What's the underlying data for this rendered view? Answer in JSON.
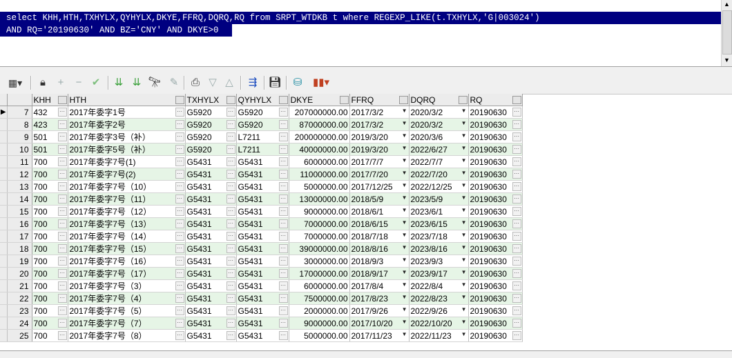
{
  "sql": {
    "line1": "select KHH,HTH,TXHYLX,QYHYLX,DKYE,FFRQ,DQRQ,RQ from SRPT_WTDKB t where REGEXP_LIKE(t.TXHYLX,'G|003024')",
    "line2": "AND RQ='20190630' AND BZ='CNY' AND DKYE>0"
  },
  "toolbar": {
    "icons": [
      "grid-menu-icon",
      "lock-icon",
      "plus-icon",
      "minus-icon",
      "check-icon",
      "filter-down-icon",
      "filter-clear-icon",
      "binoculars-icon",
      "eraser-icon",
      "print-icon",
      "arrow-down-icon",
      "arrow-up-icon",
      "connect-icon",
      "save-icon",
      "query-icon",
      "chart-icon"
    ]
  },
  "columns": [
    "KHH",
    "HTH",
    "TXHYLX",
    "QYHYLX",
    "DKYE",
    "FFRQ",
    "DQRQ",
    "RQ"
  ],
  "rows": [
    {
      "n": "7",
      "khh": "432",
      "hth": "2017年委字1号",
      "tx": "G5920",
      "qy": "G5920",
      "dkye": "207000000.00",
      "ffrq": "2017/3/2",
      "dqrq": "2020/3/2",
      "rq": "20190630"
    },
    {
      "n": "8",
      "khh": "423",
      "hth": "2017年委字2号",
      "tx": "G5920",
      "qy": "G5920",
      "dkye": "87000000.00",
      "ffrq": "2017/3/2",
      "dqrq": "2020/3/2",
      "rq": "20190630"
    },
    {
      "n": "9",
      "khh": "501",
      "hth": "2017年委字3号（补）",
      "tx": "G5920",
      "qy": "L7211",
      "dkye": "200000000.00",
      "ffrq": "2019/3/20",
      "dqrq": "2020/3/6",
      "rq": "20190630"
    },
    {
      "n": "10",
      "khh": "501",
      "hth": "2017年委字5号（补）",
      "tx": "G5920",
      "qy": "L7211",
      "dkye": "40000000.00",
      "ffrq": "2019/3/20",
      "dqrq": "2022/6/27",
      "rq": "20190630"
    },
    {
      "n": "11",
      "khh": "700",
      "hth": "2017年委字7号(1)",
      "tx": "G5431",
      "qy": "G5431",
      "dkye": "6000000.00",
      "ffrq": "2017/7/7",
      "dqrq": "2022/7/7",
      "rq": "20190630"
    },
    {
      "n": "12",
      "khh": "700",
      "hth": "2017年委字7号(2)",
      "tx": "G5431",
      "qy": "G5431",
      "dkye": "11000000.00",
      "ffrq": "2017/7/20",
      "dqrq": "2022/7/20",
      "rq": "20190630"
    },
    {
      "n": "13",
      "khh": "700",
      "hth": "2017年委字7号（10）",
      "tx": "G5431",
      "qy": "G5431",
      "dkye": "5000000.00",
      "ffrq": "2017/12/25",
      "dqrq": "2022/12/25",
      "rq": "20190630"
    },
    {
      "n": "14",
      "khh": "700",
      "hth": "2017年委字7号（11）",
      "tx": "G5431",
      "qy": "G5431",
      "dkye": "13000000.00",
      "ffrq": "2018/5/9",
      "dqrq": "2023/5/9",
      "rq": "20190630"
    },
    {
      "n": "15",
      "khh": "700",
      "hth": "2017年委字7号（12）",
      "tx": "G5431",
      "qy": "G5431",
      "dkye": "9000000.00",
      "ffrq": "2018/6/1",
      "dqrq": "2023/6/1",
      "rq": "20190630"
    },
    {
      "n": "16",
      "khh": "700",
      "hth": "2017年委字7号（13）",
      "tx": "G5431",
      "qy": "G5431",
      "dkye": "7000000.00",
      "ffrq": "2018/6/15",
      "dqrq": "2023/6/15",
      "rq": "20190630"
    },
    {
      "n": "17",
      "khh": "700",
      "hth": "2017年委字7号（14）",
      "tx": "G5431",
      "qy": "G5431",
      "dkye": "7000000.00",
      "ffrq": "2018/7/18",
      "dqrq": "2023/7/18",
      "rq": "20190630"
    },
    {
      "n": "18",
      "khh": "700",
      "hth": "2017年委字7号（15）",
      "tx": "G5431",
      "qy": "G5431",
      "dkye": "39000000.00",
      "ffrq": "2018/8/16",
      "dqrq": "2023/8/16",
      "rq": "20190630"
    },
    {
      "n": "19",
      "khh": "700",
      "hth": "2017年委字7号（16）",
      "tx": "G5431",
      "qy": "G5431",
      "dkye": "3000000.00",
      "ffrq": "2018/9/3",
      "dqrq": "2023/9/3",
      "rq": "20190630"
    },
    {
      "n": "20",
      "khh": "700",
      "hth": "2017年委字7号（17）",
      "tx": "G5431",
      "qy": "G5431",
      "dkye": "17000000.00",
      "ffrq": "2018/9/17",
      "dqrq": "2023/9/17",
      "rq": "20190630"
    },
    {
      "n": "21",
      "khh": "700",
      "hth": "2017年委字7号（3）",
      "tx": "G5431",
      "qy": "G5431",
      "dkye": "6000000.00",
      "ffrq": "2017/8/4",
      "dqrq": "2022/8/4",
      "rq": "20190630"
    },
    {
      "n": "22",
      "khh": "700",
      "hth": "2017年委字7号（4）",
      "tx": "G5431",
      "qy": "G5431",
      "dkye": "7500000.00",
      "ffrq": "2017/8/23",
      "dqrq": "2022/8/23",
      "rq": "20190630"
    },
    {
      "n": "23",
      "khh": "700",
      "hth": "2017年委字7号（5）",
      "tx": "G5431",
      "qy": "G5431",
      "dkye": "2000000.00",
      "ffrq": "2017/9/26",
      "dqrq": "2022/9/26",
      "rq": "20190630"
    },
    {
      "n": "24",
      "khh": "700",
      "hth": "2017年委字7号（7）",
      "tx": "G5431",
      "qy": "G5431",
      "dkye": "9000000.00",
      "ffrq": "2017/10/20",
      "dqrq": "2022/10/20",
      "rq": "20190630"
    },
    {
      "n": "25",
      "khh": "700",
      "hth": "2017年委字7号（8）",
      "tx": "G5431",
      "qy": "G5431",
      "dkye": "5000000.00",
      "ffrq": "2017/11/23",
      "dqrq": "2022/11/23",
      "rq": "20190630"
    }
  ],
  "colors": {
    "selection": "#000080",
    "row_alt": "#e6f5e6",
    "header": "#ececec"
  }
}
